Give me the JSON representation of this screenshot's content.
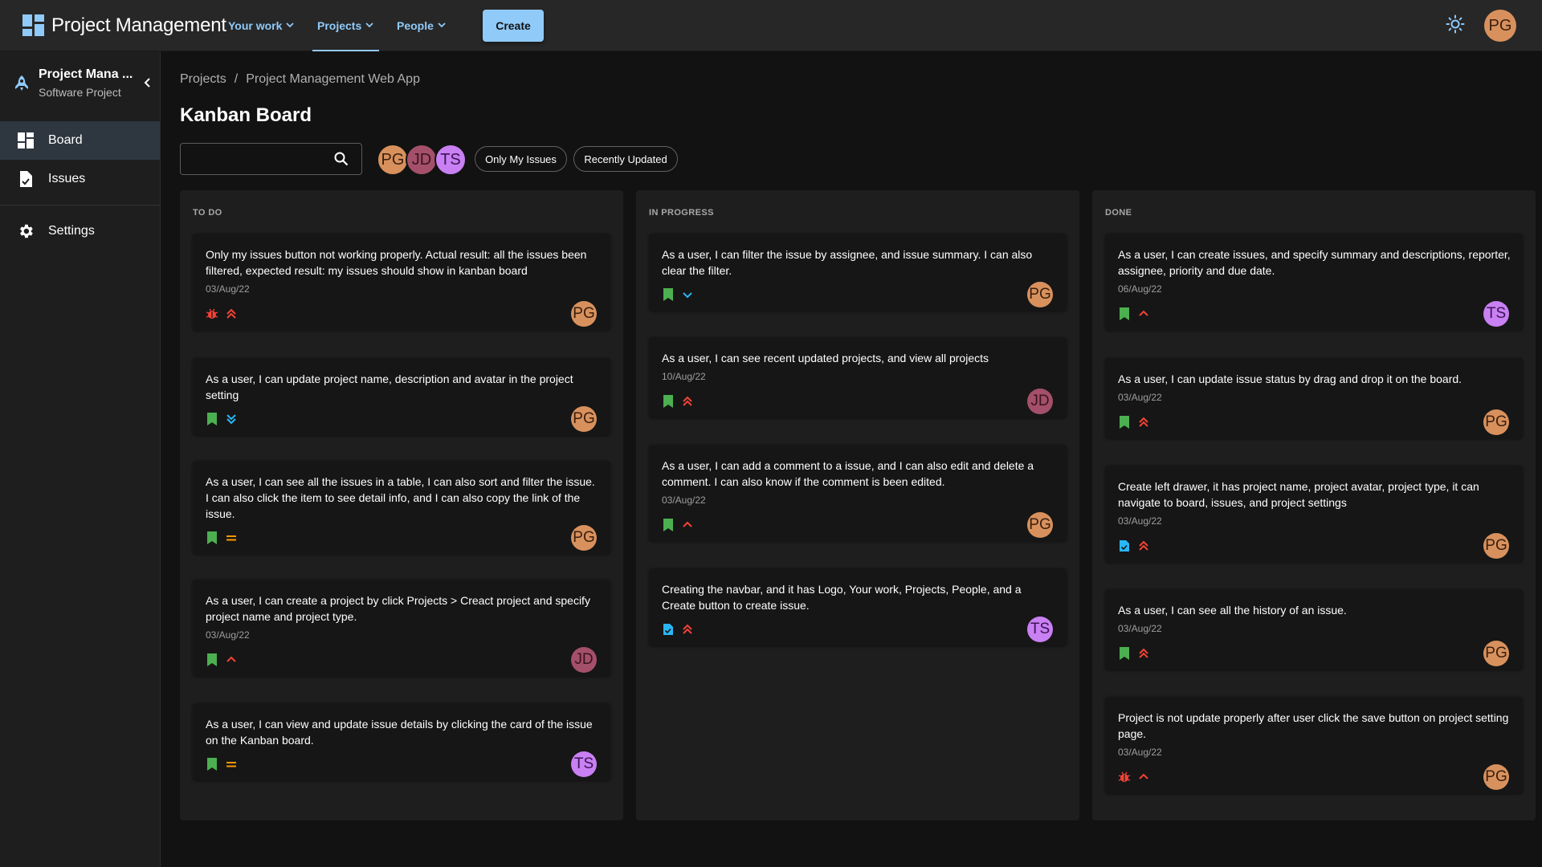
{
  "navbar": {
    "app_title": "Project Management",
    "links": [
      {
        "label": "Your work"
      },
      {
        "label": "Projects"
      },
      {
        "label": "People"
      }
    ],
    "create_label": "Create",
    "user_initials": "PG"
  },
  "sidebar": {
    "project_name": "Project Mana ...",
    "project_type": "Software Project",
    "items": [
      {
        "label": "Board",
        "icon": "dashboard-icon"
      },
      {
        "label": "Issues",
        "icon": "task-icon"
      },
      {
        "label": "Settings",
        "icon": "gear-icon"
      }
    ]
  },
  "breadcrumb": {
    "items": [
      "Projects",
      "Project Management Web App"
    ],
    "separator": "/"
  },
  "page_title": "Kanban Board",
  "search": {
    "value": "",
    "placeholder": ""
  },
  "filters": {
    "avatars": [
      "PG",
      "JD",
      "TS"
    ],
    "chips": [
      "Only My Issues",
      "Recently Updated"
    ]
  },
  "colors": {
    "accent": "#90caf9",
    "story": "#4caf50",
    "bug": "#f44336",
    "task": "#29b6f6",
    "priority_high": "#f44336",
    "priority_medium": "#ff9800",
    "priority_low": "#29b6f6",
    "avatar_PG": "#d8915d",
    "avatar_JD": "#a4506a",
    "avatar_TS": "#c880f2"
  },
  "board": {
    "columns": [
      {
        "title": "TO DO",
        "cards": [
          {
            "summary": "Only my issues button not working properly. Actual result: all the issues been filtered, expected result: my issues should show in kanban board",
            "date": "03/Aug/22",
            "type": "bug",
            "priority": "highest",
            "assignee": "PG"
          },
          {
            "summary": "As a user, I can update project name, description and avatar in the project setting",
            "date": "",
            "type": "story",
            "priority": "lowest",
            "assignee": "PG"
          },
          {
            "summary": "As a user, I can see all the issues in a table, I can also sort and filter the issue. I can also click the item to see detail info, and I can also copy the link of the issue.",
            "date": "",
            "type": "story",
            "priority": "medium",
            "assignee": "PG"
          },
          {
            "summary": "As a user, I can create a project by click Projects > Creact project and specify project name and project type.",
            "date": "03/Aug/22",
            "type": "story",
            "priority": "high",
            "assignee": "JD"
          },
          {
            "summary": "As a user, I can view and update issue details by clicking the card of the issue on the Kanban board.",
            "date": "",
            "type": "story",
            "priority": "medium",
            "assignee": "TS"
          }
        ]
      },
      {
        "title": "IN PROGRESS",
        "cards": [
          {
            "summary": "As a user, I can filter the issue by assignee, and issue summary. I can also clear the filter.",
            "date": "",
            "type": "story",
            "priority": "low",
            "assignee": "PG"
          },
          {
            "summary": "As a user, I can see recent updated projects, and view all projects",
            "date": "10/Aug/22",
            "type": "story",
            "priority": "highest",
            "assignee": "JD"
          },
          {
            "summary": "As a user, I can add a comment to a issue, and I can also edit and delete a comment. I can also know if the comment is been edited.",
            "date": "03/Aug/22",
            "type": "story",
            "priority": "high",
            "assignee": "PG"
          },
          {
            "summary": "Creating the navbar, and it has Logo, Your work, Projects, People, and a Create button to create issue.",
            "date": "",
            "type": "task",
            "priority": "highest",
            "assignee": "TS"
          }
        ]
      },
      {
        "title": "DONE",
        "cards": [
          {
            "summary": "As a user, I can create issues, and specify summary and descriptions, reporter, assignee, priority and due date.",
            "date": "06/Aug/22",
            "type": "story",
            "priority": "high",
            "assignee": "TS"
          },
          {
            "summary": "As a user, I can update issue status by drag and drop it on the board.",
            "date": "03/Aug/22",
            "type": "story",
            "priority": "highest",
            "assignee": "PG"
          },
          {
            "summary": "Create left drawer, it has project name, project avatar, project type, it can navigate to board, issues, and project settings",
            "date": "03/Aug/22",
            "type": "task",
            "priority": "highest",
            "assignee": "PG"
          },
          {
            "summary": "As a user, I can see all the history of an issue.",
            "date": "03/Aug/22",
            "type": "story",
            "priority": "highest",
            "assignee": "PG"
          },
          {
            "summary": "Project is not update properly after user click the save button on project setting page.",
            "date": "03/Aug/22",
            "type": "bug",
            "priority": "high",
            "assignee": "PG"
          }
        ]
      }
    ]
  }
}
